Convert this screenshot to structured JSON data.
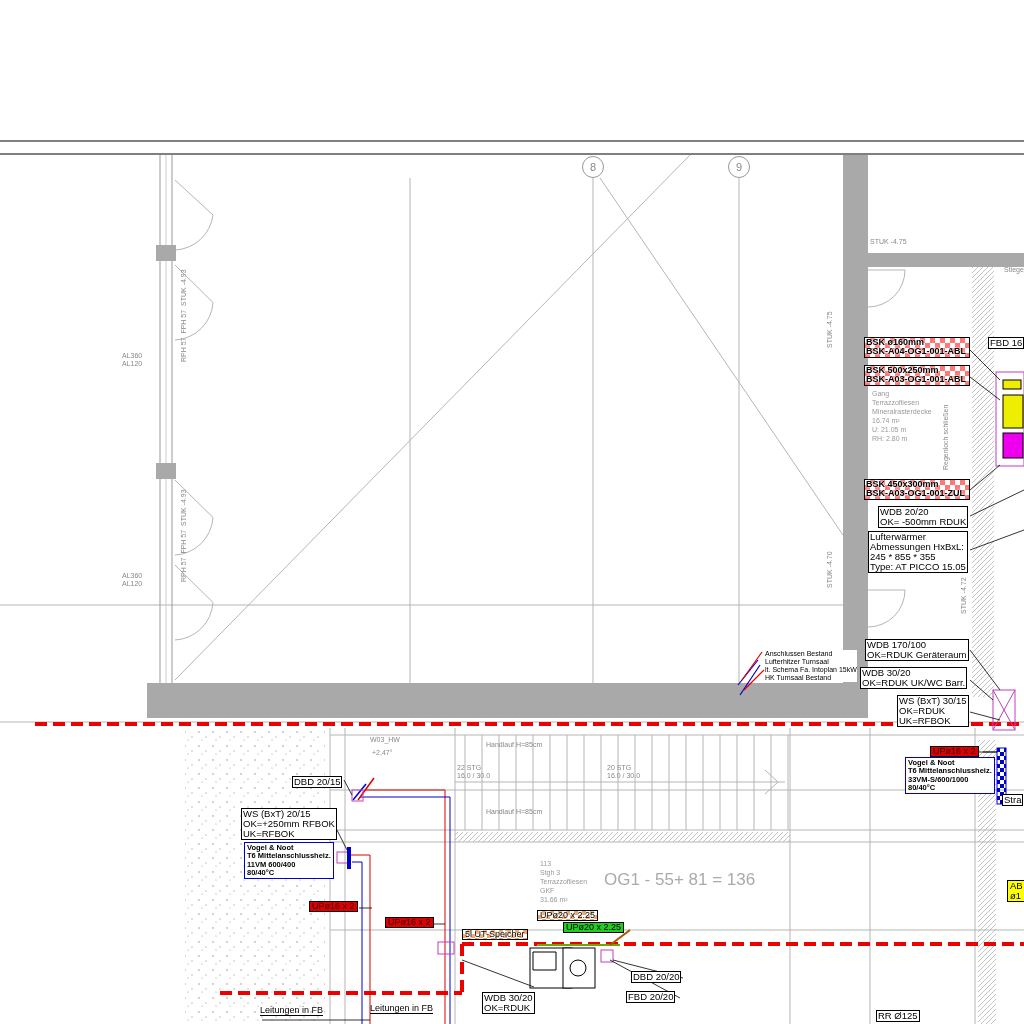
{
  "grid_markers": [
    {
      "label": "8"
    },
    {
      "label": "9"
    }
  ],
  "callouts": [
    {
      "kind": "hatched",
      "lines": [
        "BSK ø160mm",
        "BSK-A04-OG1-001-ABL"
      ]
    },
    {
      "kind": "hatched",
      "lines": [
        "BSK 500x250mm",
        "BSK-A03-OG1-001-ABL"
      ]
    },
    {
      "kind": "boxed",
      "lines": [
        "FBD 16"
      ]
    },
    {
      "kind": "hatched",
      "lines": [
        "BSK 450x300mm",
        "BSK-A03-OG1-001-ZUL"
      ]
    },
    {
      "kind": "boxed",
      "lines": [
        "WDB 20/20",
        "OK= -500mm RDUK"
      ]
    },
    {
      "kind": "boxed",
      "lines": [
        "Lufterwärmer",
        "Abmessungen HxBxL:",
        "245 * 855 * 355",
        "Type: AT PICCO 15.05"
      ]
    },
    {
      "kind": "boxed",
      "lines": [
        "WDB 170/100",
        "OK=RDUK Geräteraum"
      ]
    },
    {
      "kind": "boxed",
      "lines": [
        "WDB 30/20",
        "OK=RDUK UK/WC Barr."
      ]
    },
    {
      "kind": "boxed",
      "lines": [
        "WS (BxT) 30/15",
        "OK=RDUK",
        "UK=RFBOK"
      ]
    },
    {
      "kind": "red",
      "lines": [
        "UPø16 x 2"
      ]
    },
    {
      "kind": "blue",
      "lines": [
        "Vogel & Noot",
        "T6 Mittelanschlussheiz.",
        "33VM-S/600/1000",
        "80/40°C"
      ]
    },
    {
      "kind": "boxed",
      "lines": [
        "Stra"
      ]
    },
    {
      "kind": "boxed",
      "lines": [
        "DBD 20/15"
      ]
    },
    {
      "kind": "boxed",
      "lines": [
        "WS (BxT) 20/15",
        "OK=+250mm RFBOK",
        "UK=RFBOK"
      ]
    },
    {
      "kind": "blue",
      "lines": [
        "Vogel & Noot",
        "T6 Mittelanschlussheiz.",
        "11VM 600/400",
        "80/40°C"
      ]
    },
    {
      "kind": "red",
      "lines": [
        "UPø16 x 2"
      ]
    },
    {
      "kind": "red",
      "lines": [
        "UPø16 x 2"
      ]
    },
    {
      "kind": "orange",
      "lines": [
        "UPø20 x 2.25"
      ]
    },
    {
      "kind": "green",
      "lines": [
        "UPø20 x 2.25"
      ]
    },
    {
      "kind": "orange",
      "lines": [
        "5l UT-Speicher"
      ]
    },
    {
      "kind": "boxed",
      "lines": [
        "DBD 20/20"
      ]
    },
    {
      "kind": "boxed",
      "lines": [
        "WDB 30/20",
        "OK=RDUK"
      ]
    },
    {
      "kind": "boxed",
      "lines": [
        "FBD 20/20"
      ]
    },
    {
      "kind": "plain",
      "lines": [
        "Leitungen in FB"
      ]
    },
    {
      "kind": "plain",
      "lines": [
        "Leitungen in FB"
      ]
    },
    {
      "kind": "yellow",
      "lines": [
        "AB",
        "ø1"
      ]
    },
    {
      "kind": "boxed",
      "lines": [
        "RR Ø125"
      ]
    }
  ],
  "room_labels": [
    {
      "lines": [
        "Gang",
        "Terrazzofliesen",
        "Mineralrasterdecke",
        "16.74 m²",
        "U: 21.05 m",
        "RH: 2.80 m"
      ]
    },
    {
      "lines": [
        "113",
        "Stgh 3",
        "Terrazzofliesen",
        "GKF",
        "31.66 m²"
      ]
    }
  ],
  "area_formula": "OG1 - 55+ 81 = 136",
  "legend": [
    "Anschlussen Bestand",
    "Lufterhitzer Turnsaal",
    "lt. Schema Fa. Intoplan 15kW",
    "HK Turnsaal Bestand"
  ],
  "notes": [
    {
      "kind": "horizontal",
      "text": "STUK -4.75"
    },
    {
      "kind": "vertical",
      "text": "STUK -4.75"
    },
    {
      "kind": "vertical",
      "text": "STUK -4.70"
    },
    {
      "kind": "vertical",
      "text": "Regenloch schließen"
    },
    {
      "kind": "horizontal",
      "text": "Stiege"
    },
    {
      "kind": "horizontal",
      "text": "+2,47°"
    },
    {
      "kind": "horizontal",
      "text": "Handlauf H=85cm"
    },
    {
      "kind": "horizontal",
      "text": "Handlauf H=85cm"
    },
    {
      "kind": "horizontal",
      "text": "22 STG\n16.0 / 30.0"
    },
    {
      "kind": "horizontal",
      "text": "20 STG\n16.0 / 30.0"
    },
    {
      "kind": "horizontal",
      "text": "AL360\nAL120"
    },
    {
      "kind": "horizontal",
      "text": "AL360\nAL120"
    },
    {
      "kind": "vertical",
      "text": "RPH 57  FPH 57  STUK -4.93"
    },
    {
      "kind": "vertical",
      "text": "RPH 57  FPH 57  STUK -4.93"
    },
    {
      "kind": "horizontal",
      "text": "W03_HW"
    },
    {
      "kind": "vertical",
      "text": "STUK -4.72"
    }
  ]
}
